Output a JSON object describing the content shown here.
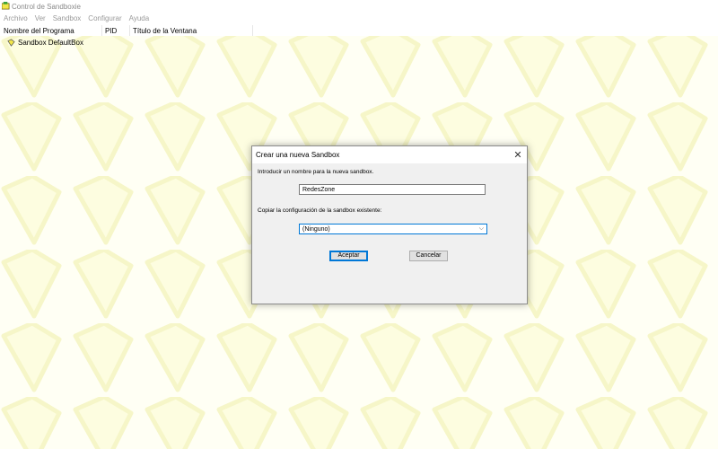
{
  "window": {
    "title": "Control de Sandboxie"
  },
  "menu": [
    "Archivo",
    "Ver",
    "Sandbox",
    "Configurar",
    "Ayuda"
  ],
  "columns": [
    "Nombre del Programa",
    "PID",
    "Título de la Ventana"
  ],
  "tree": {
    "sandbox_label": "Sandbox DefaultBox"
  },
  "dialog": {
    "title": "Crear una nueva Sandbox",
    "close_glyph": "✕",
    "name_prompt": "Introducir un nombre para la nueva sandbox.",
    "name_value": "RedesZone",
    "copy_prompt": "Copiar la configuración de la sandbox existente:",
    "copy_selected": "(Ninguno)",
    "ok_label": "Aceptar",
    "cancel_label": "Cancelar"
  },
  "colors": {
    "accent": "#0078d7",
    "tile": "#fafad2",
    "icon": "#f2e64a"
  },
  "icons": {
    "app": "sandboxie-icon",
    "sandbox": "sandbox-icon",
    "close": "close-icon",
    "dropdown": "chevron-down-icon"
  }
}
